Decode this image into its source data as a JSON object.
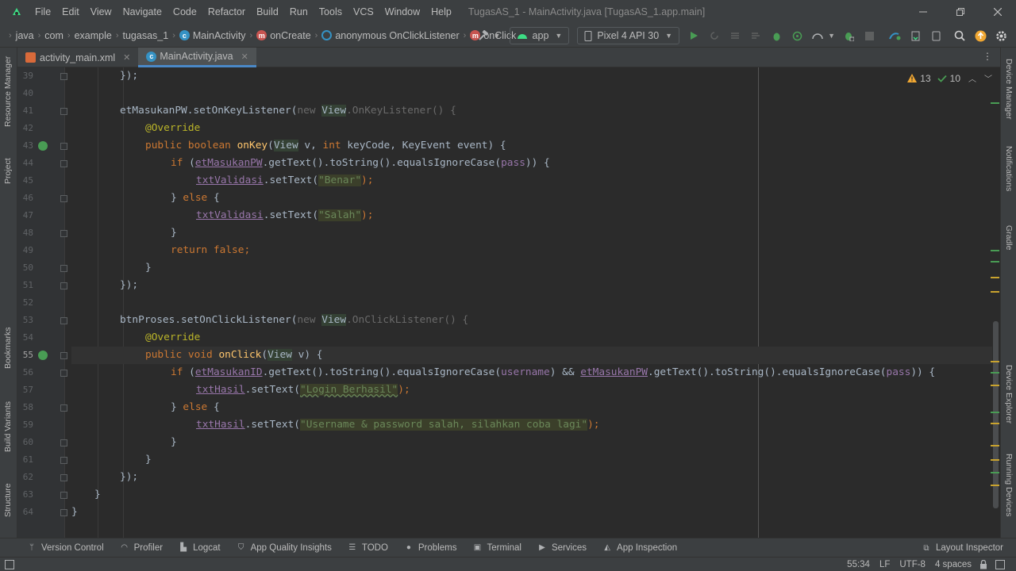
{
  "menubar": {
    "items": [
      "File",
      "Edit",
      "View",
      "Navigate",
      "Code",
      "Refactor",
      "Build",
      "Run",
      "Tools",
      "VCS",
      "Window",
      "Help"
    ],
    "title": "TugasAS_1 - MainActivity.java [TugasAS_1.app.main]"
  },
  "breadcrumb": {
    "items": [
      "java",
      "com",
      "example",
      "tugasas_1",
      "MainActivity",
      "onCreate",
      "anonymous OnClickListener",
      "onClick"
    ]
  },
  "toolbar": {
    "run_config": "app",
    "device": "Pixel 4 API 30"
  },
  "tabs": [
    {
      "label": "activity_main.xml"
    },
    {
      "label": "MainActivity.java"
    }
  ],
  "editor": {
    "warnings": "13",
    "checks": "10",
    "current_line": "55",
    "line_numbers": [
      "39",
      "40",
      "41",
      "42",
      "43",
      "44",
      "45",
      "46",
      "47",
      "48",
      "49",
      "50",
      "51",
      "52",
      "53",
      "54",
      "55",
      "56",
      "57",
      "58",
      "59",
      "60",
      "61",
      "62",
      "63",
      "64"
    ],
    "code": {
      "l39": "});",
      "l41_a": "etMasukanPW.setOnKeyListener(",
      "l41_new": "new ",
      "l41_view": "View",
      "l41_b": ".OnKeyListener() {",
      "l42": "@Override",
      "l43_kw": "public boolean ",
      "l43_fn": "onKey",
      "l43_a": "(",
      "l43_view": "View",
      "l43_b": " v, ",
      "l43_int": "int",
      "l43_c": " keyCode, KeyEvent event) {",
      "l44_if": "if ",
      "l44_a": "(",
      "l44_f": "etMasukanPW",
      "l44_b": ".getText().toString().equalsIgnoreCase(",
      "l44_pass": "pass",
      "l44_c": ")) {",
      "l45_f": "txtValidasi",
      "l45_a": ".setText(",
      "l45_s": "\"Benar\"",
      "l45_b": ");",
      "l46_a": "} ",
      "l46_else": "else",
      "l46_b": " {",
      "l47_f": "txtValidasi",
      "l47_a": ".setText(",
      "l47_s": "\"Salah\"",
      "l47_b": ");",
      "l48": "}",
      "l49_ret": "return false",
      "l49_a": ";",
      "l50": "}",
      "l51": "});",
      "l53_a": "btnProses.setOnClickListener(",
      "l53_new": "new ",
      "l53_view": "View",
      "l53_b": ".OnClickListener() {",
      "l54": "@Override",
      "l55_kw": "public void ",
      "l55_fn": "onClick",
      "l55_a": "(",
      "l55_view": "View",
      "l55_b": " v) {",
      "l56_if": "if ",
      "l56_a": "(",
      "l56_f1": "etMasukanID",
      "l56_b": ".getText().toString().equalsIgnoreCase(",
      "l56_user": "username",
      "l56_c": ") && ",
      "l56_f2": "etMasukanPW",
      "l56_d": ".getText().toString().equalsIgnoreCase(",
      "l56_pass": "pass",
      "l56_e": ")) {",
      "l57_f": "txtHasil",
      "l57_a": ".setText(",
      "l57_s": "\"Login Berhasil\"",
      "l57_b": ");",
      "l58_a": "} ",
      "l58_else": "else",
      "l58_b": " {",
      "l59_f": "txtHasil",
      "l59_a": ".setText(",
      "l59_s": "\"Username & password salah, silahkan coba lagi\"",
      "l59_b": ");",
      "l60": "}",
      "l61": "}",
      "l62": "});",
      "l63": "}",
      "l64": "}"
    }
  },
  "left_strip": [
    "Resource Manager",
    "Project",
    "Bookmarks",
    "Build Variants",
    "Structure"
  ],
  "right_strip": [
    "Device Manager",
    "Notifications",
    "Gradle",
    "Device Explorer",
    "Running Devices"
  ],
  "tool_windows": [
    "Version Control",
    "Profiler",
    "Logcat",
    "App Quality Insights",
    "TODO",
    "Problems",
    "Terminal",
    "Services",
    "App Inspection"
  ],
  "layout_inspector": "Layout Inspector",
  "status": {
    "position": "55:34",
    "line_sep": "LF",
    "encoding": "UTF-8",
    "indent": "4 spaces"
  },
  "colors": {
    "background": "#2b2b2b",
    "panel": "#3c3f41",
    "keyword": "#cc7832",
    "method": "#ffc66d",
    "annotation": "#bbb529",
    "field": "#9876aa",
    "string": "#6a8759"
  }
}
